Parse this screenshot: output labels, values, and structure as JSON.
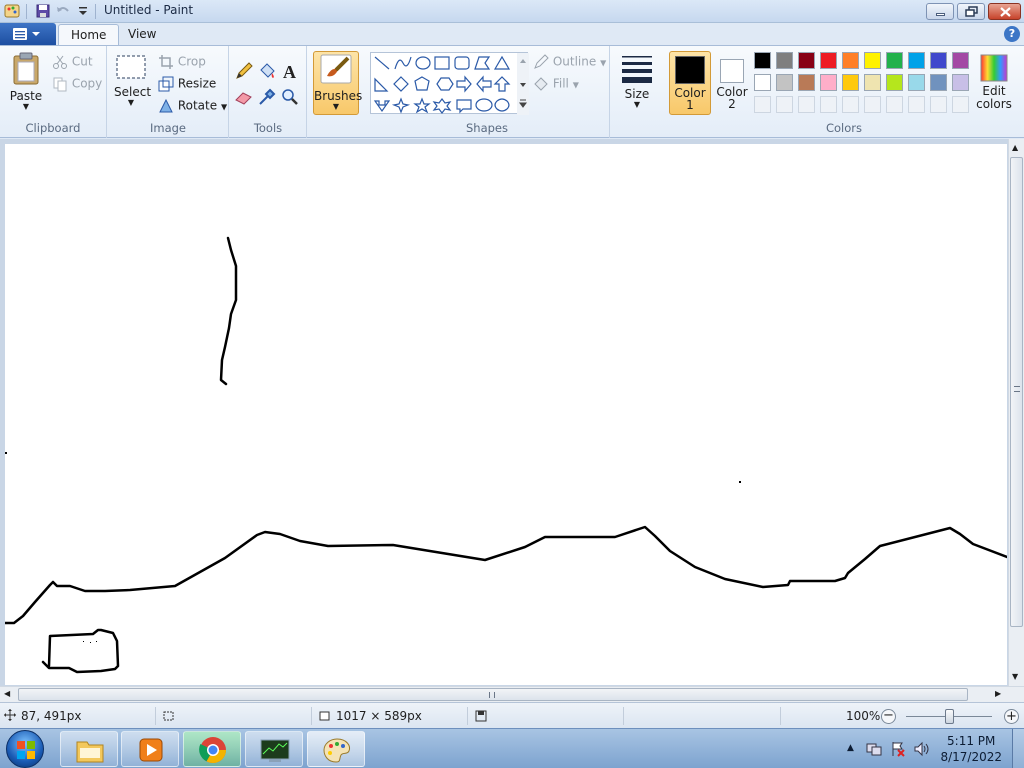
{
  "window": {
    "title": "Untitled - Paint"
  },
  "tabs": [
    {
      "label": "Home"
    },
    {
      "label": "View"
    }
  ],
  "ribbon": {
    "clipboard": {
      "paste": "Paste",
      "cut": "Cut",
      "copy": "Copy",
      "group": "Clipboard"
    },
    "image": {
      "select": "Select",
      "crop": "Crop",
      "resize": "Resize",
      "rotate": "Rotate",
      "group": "Image"
    },
    "tools": {
      "group": "Tools"
    },
    "brushes": {
      "label": "Brushes"
    },
    "shapes": {
      "outline": "Outline",
      "fill": "Fill",
      "group": "Shapes"
    },
    "size": {
      "label": "Size"
    },
    "colors": {
      "color1": "Color",
      "color1_num": "1",
      "color2": "Color",
      "color2_num": "2",
      "edit": "Edit",
      "edit2": "colors",
      "group": "Colors",
      "palette_row1": [
        "#000000",
        "#7f7f7f",
        "#880015",
        "#ed1c24",
        "#ff7f27",
        "#fff200",
        "#22b14c",
        "#00a2e8",
        "#3f48cc",
        "#a349a4"
      ],
      "palette_row2": [
        "#ffffff",
        "#c3c3c3",
        "#b97a57",
        "#ffaec9",
        "#ffc90e",
        "#efe4b0",
        "#b5e61d",
        "#99d9ea",
        "#7092be",
        "#c8bfe7"
      ],
      "color1_value": "#000000",
      "color2_value": "#ffffff"
    }
  },
  "status": {
    "cursor_pos": "87, 491px",
    "canvas_size": "1017 × 589px",
    "zoom": "100%"
  },
  "taskbar": {
    "time": "5:11 PM",
    "date": "8/17/2022",
    "apps": [
      "start-orb",
      "file-explorer",
      "media-player",
      "chrome",
      "task-manager",
      "paint"
    ]
  }
}
